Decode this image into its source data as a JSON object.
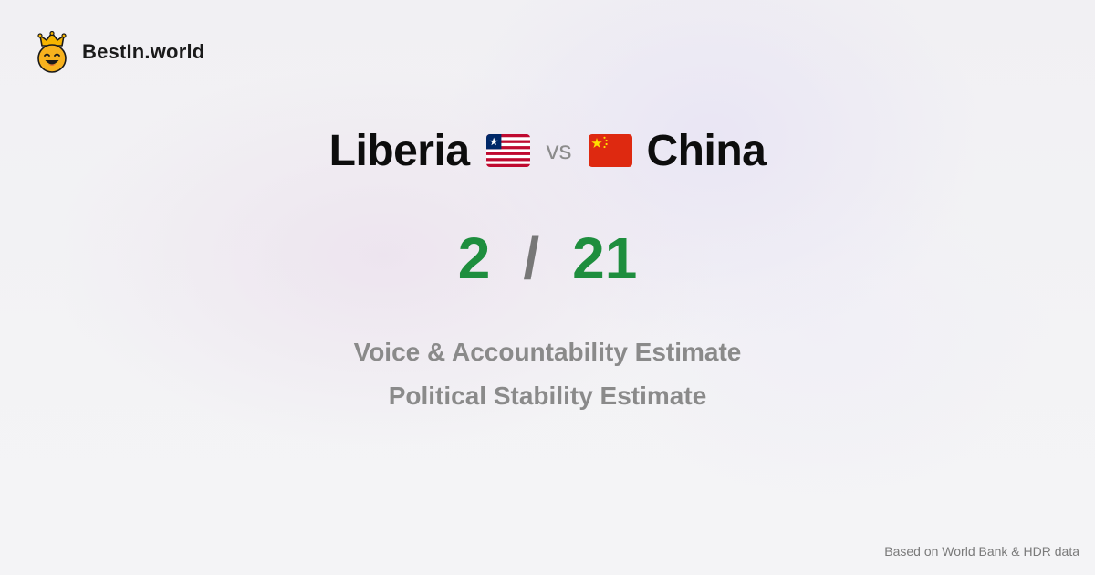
{
  "brand": {
    "name": "BestIn.world",
    "logo_icon": "crown-smiley-icon"
  },
  "comparison": {
    "left_country": "Liberia",
    "left_flag_icon": "liberia-flag-icon",
    "vs_label": "vs",
    "right_country": "China",
    "right_flag_icon": "china-flag-icon"
  },
  "score": {
    "left": "2",
    "separator": "/",
    "right": "21",
    "color": "#1e8e3e"
  },
  "metrics": [
    "Voice & Accountability Estimate",
    "Political Stability Estimate"
  ],
  "footer": {
    "source_text": "Based on World Bank & HDR data"
  }
}
